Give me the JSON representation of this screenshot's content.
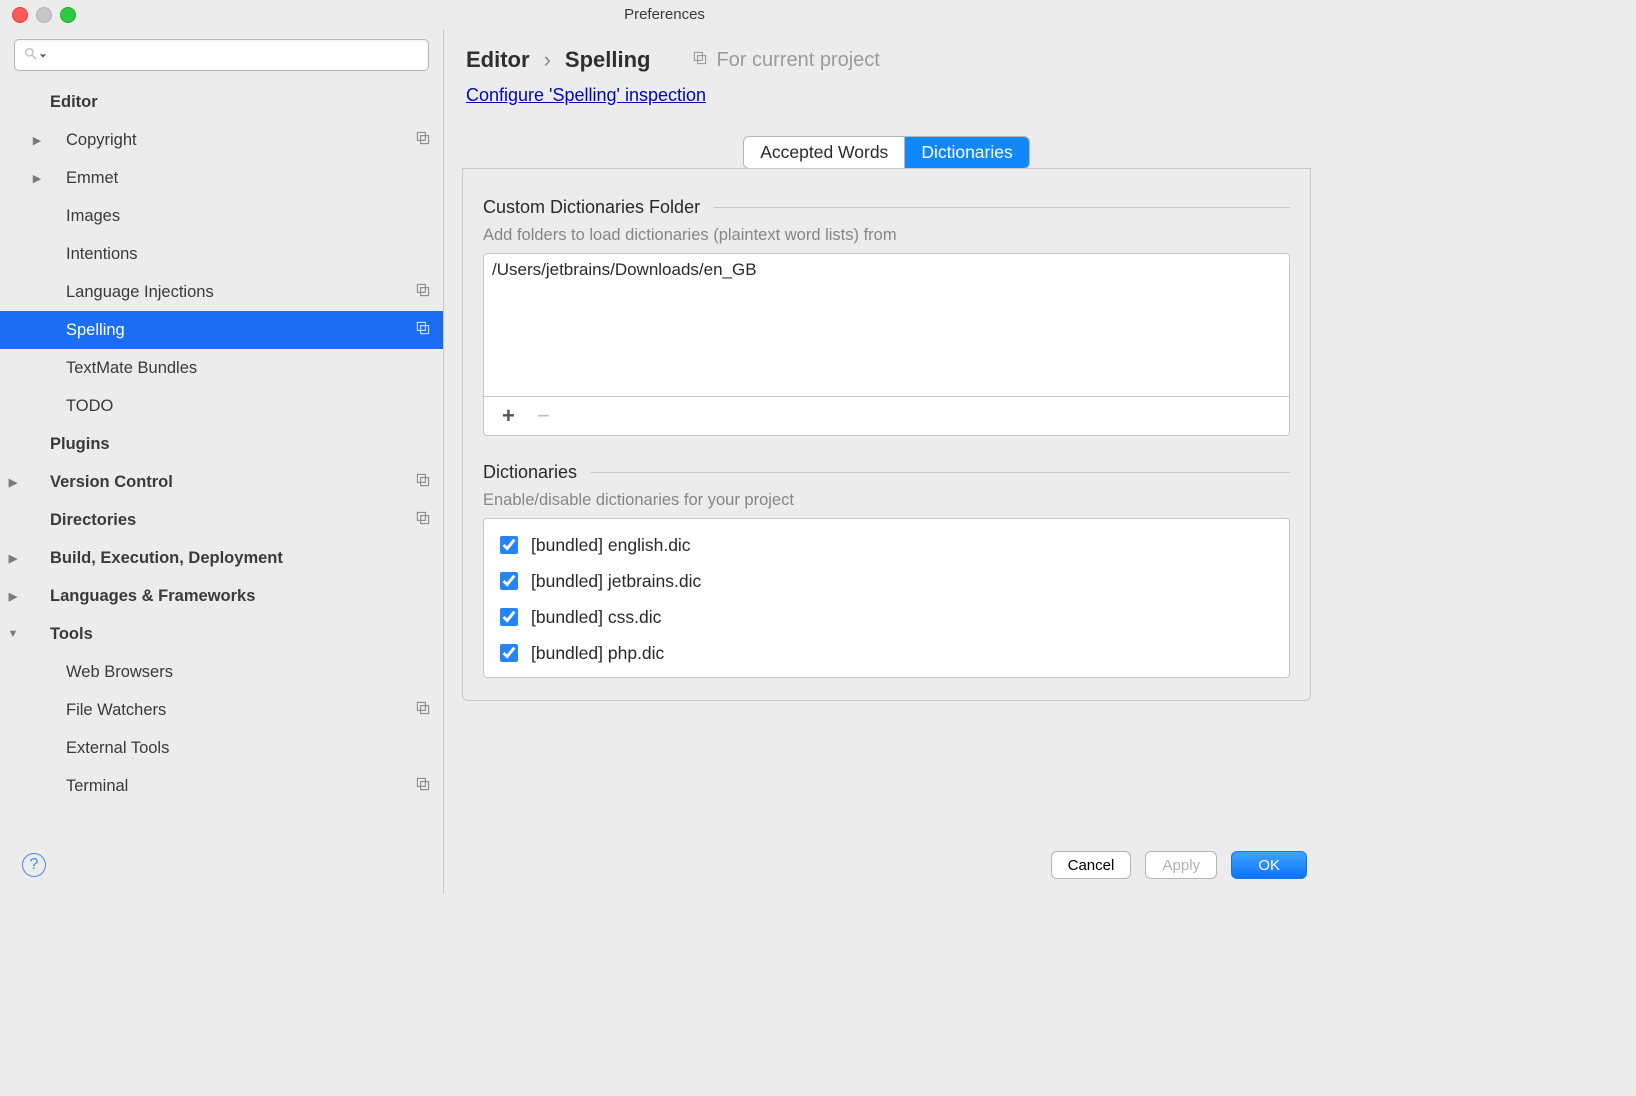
{
  "window_title": "Preferences",
  "search_placeholder": "",
  "sidebar": [
    {
      "label": "Editor",
      "level": 1,
      "kind": "section",
      "disclosure": "none",
      "proj": false
    },
    {
      "label": "Copyright",
      "level": 2,
      "kind": "item",
      "disclosure": "right",
      "proj": true
    },
    {
      "label": "Emmet",
      "level": 2,
      "kind": "item",
      "disclosure": "right",
      "proj": false
    },
    {
      "label": "Images",
      "level": 2,
      "kind": "item",
      "disclosure": "none",
      "proj": false
    },
    {
      "label": "Intentions",
      "level": 2,
      "kind": "item",
      "disclosure": "none",
      "proj": false
    },
    {
      "label": "Language Injections",
      "level": 2,
      "kind": "item",
      "disclosure": "none",
      "proj": true
    },
    {
      "label": "Spelling",
      "level": 2,
      "kind": "item",
      "disclosure": "none",
      "proj": true,
      "selected": true
    },
    {
      "label": "TextMate Bundles",
      "level": 2,
      "kind": "item",
      "disclosure": "none",
      "proj": false
    },
    {
      "label": "TODO",
      "level": 2,
      "kind": "item",
      "disclosure": "none",
      "proj": false
    },
    {
      "label": "Plugins",
      "level": 1,
      "kind": "section",
      "disclosure": "none",
      "proj": false
    },
    {
      "label": "Version Control",
      "level": 1,
      "kind": "section",
      "disclosure": "right",
      "proj": true
    },
    {
      "label": "Directories",
      "level": 1,
      "kind": "section",
      "disclosure": "none",
      "proj": true
    },
    {
      "label": "Build, Execution, Deployment",
      "level": 1,
      "kind": "section",
      "disclosure": "right",
      "proj": false
    },
    {
      "label": "Languages & Frameworks",
      "level": 1,
      "kind": "section",
      "disclosure": "right",
      "proj": false
    },
    {
      "label": "Tools",
      "level": 1,
      "kind": "section",
      "disclosure": "down",
      "proj": false
    },
    {
      "label": "Web Browsers",
      "level": 2,
      "kind": "item",
      "disclosure": "none",
      "proj": false
    },
    {
      "label": "File Watchers",
      "level": 2,
      "kind": "item",
      "disclosure": "none",
      "proj": true
    },
    {
      "label": "External Tools",
      "level": 2,
      "kind": "item",
      "disclosure": "none",
      "proj": false
    },
    {
      "label": "Terminal",
      "level": 2,
      "kind": "item",
      "disclosure": "none",
      "proj": true
    }
  ],
  "breadcrumb": {
    "root": "Editor",
    "page": "Spelling",
    "scope": "For current project"
  },
  "configure_link": "Configure 'Spelling' inspection",
  "tabs": [
    {
      "label": "Accepted Words",
      "active": false
    },
    {
      "label": "Dictionaries",
      "active": true
    }
  ],
  "custom_folder": {
    "title": "Custom Dictionaries Folder",
    "hint": "Add folders to load dictionaries (plaintext word lists) from",
    "entries": [
      "/Users/jetbrains/Downloads/en_GB"
    ]
  },
  "dicts": {
    "title": "Dictionaries",
    "hint": "Enable/disable dictionaries for your project",
    "items": [
      {
        "label": "[bundled] english.dic",
        "checked": true
      },
      {
        "label": "[bundled] jetbrains.dic",
        "checked": true
      },
      {
        "label": "[bundled] css.dic",
        "checked": true
      },
      {
        "label": "[bundled] php.dic",
        "checked": true
      }
    ]
  },
  "buttons": {
    "cancel": "Cancel",
    "apply": "Apply",
    "ok": "OK"
  }
}
